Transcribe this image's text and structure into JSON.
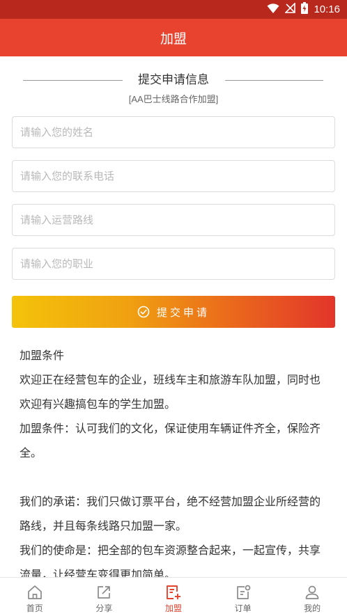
{
  "status_bar": {
    "time": "10:16"
  },
  "header": {
    "title": "加盟"
  },
  "form": {
    "section_title": "提交申请信息",
    "subtitle": "[AA巴士线路合作加盟]",
    "name_placeholder": "请输入您的姓名",
    "phone_placeholder": "请输入您的联系电话",
    "route_placeholder": "请输入运营路线",
    "job_placeholder": "请输入您的职业",
    "submit_label": "提交申请"
  },
  "terms": {
    "lines": [
      "加盟条件",
      "欢迎正在经营包车的企业，班线车主和旅游车队加盟，同时也欢迎有兴趣搞包车的学生加盟。",
      "加盟条件：认可我们的文化，保证使用车辆证件齐全，保险齐全。",
      "",
      "我们的承诺：我们只做订票平台，绝不经营加盟企业所经营的路线，并且每条线路只加盟一家。",
      "我们的使命是：把全部的包车资源整合起来，一起宣传，共享流量，让经营车变得更加简单。"
    ]
  },
  "tabs": [
    {
      "label": "首页",
      "icon": "home-icon"
    },
    {
      "label": "分享",
      "icon": "share-icon"
    },
    {
      "label": "加盟",
      "icon": "join-icon",
      "active": true
    },
    {
      "label": "订单",
      "icon": "order-icon"
    },
    {
      "label": "我的",
      "icon": "user-icon"
    }
  ],
  "colors": {
    "primary": "#e8432f",
    "status_bar": "#b8281d",
    "gradient_start": "#f4c30a",
    "gradient_end": "#e2352a"
  }
}
